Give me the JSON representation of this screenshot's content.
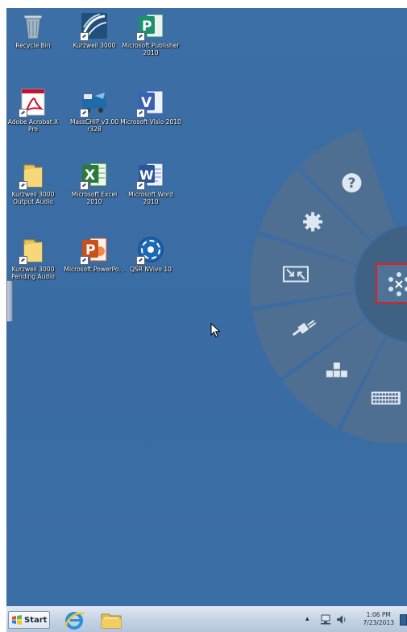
{
  "desktop": {
    "icons": [
      {
        "label": "Recycle Bin",
        "icon": "recycle-bin-icon"
      },
      {
        "label": "Kurzweil 3000",
        "icon": "kurzweil-icon"
      },
      {
        "label": "Microsoft Publisher 2010",
        "icon": "publisher-icon"
      },
      {
        "label": "Adobe Acrobat X Pro",
        "icon": "acrobat-icon"
      },
      {
        "label": "MassCHIP v3.00 r328",
        "icon": "masschip-icon"
      },
      {
        "label": "Microsoft Visio 2010",
        "icon": "visio-icon"
      },
      {
        "label": "Kurzweil 3000 Output Audio",
        "icon": "folder-icon"
      },
      {
        "label": "Microsoft Excel 2010",
        "icon": "excel-icon"
      },
      {
        "label": "Microsoft Word 2010",
        "icon": "word-icon"
      },
      {
        "label": "Kurzweil 3000 Pending Audio",
        "icon": "folder-icon"
      },
      {
        "label": "Microsoft PowerPo...",
        "icon": "powerpoint-icon"
      },
      {
        "label": "QSR NVivo 10",
        "icon": "nvivo-icon"
      }
    ]
  },
  "radial_menu": {
    "segments": [
      {
        "icon": "help-icon"
      },
      {
        "icon": "settings-icon"
      },
      {
        "icon": "shrink-icon"
      },
      {
        "icon": "plug-icon"
      },
      {
        "icon": "arrow-keys-icon"
      },
      {
        "icon": "keyboard-icon"
      },
      {
        "icon": "touchpad-icon"
      }
    ],
    "center_icon": "center-options-icon"
  },
  "taskbar": {
    "start_label": "Start",
    "pinned": [
      {
        "icon": "internet-explorer-icon"
      },
      {
        "icon": "file-explorer-icon"
      }
    ],
    "clock_time": "1:06 PM",
    "clock_date": "7/23/2013"
  },
  "colors": {
    "desktop": "#3b6ea5",
    "radial_segment": "#4f6f92",
    "radial_hub": "#3f6184",
    "highlight": "#e02020"
  }
}
